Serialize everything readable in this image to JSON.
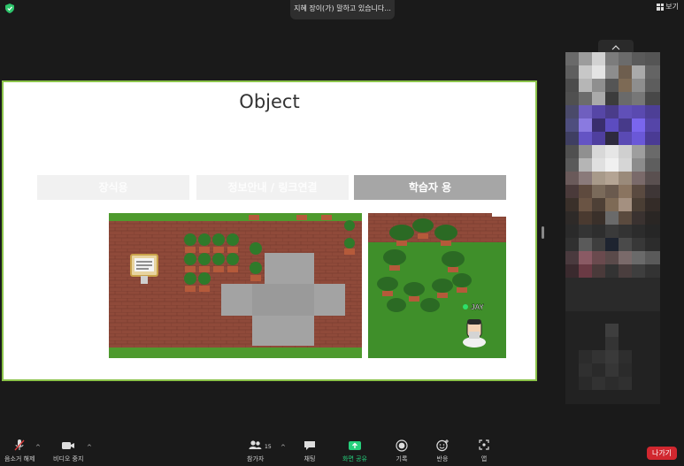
{
  "topbar": {
    "speaking_text": "지혜 장이(가) 말하고 있습니다...",
    "view_label": "보기"
  },
  "slide": {
    "title": "Object",
    "categories": [
      "장식용",
      "정보안내 / 링크연결",
      "학습자 용"
    ],
    "avatar_name": "JAY"
  },
  "toolbar": {
    "mute_label": "음소거 해제",
    "video_label": "비디오 중지",
    "participants_label": "참가자",
    "participants_count": "15",
    "chat_label": "채팅",
    "share_label": "화면 공유",
    "record_label": "기록",
    "reactions_label": "반응",
    "apps_label": "앱",
    "leave_label": "나가기"
  },
  "colors": {
    "slide_border": "#8bc34a",
    "share_green": "#26d07c",
    "leave_red": "#d1272f",
    "background": "#1a1a1a"
  }
}
